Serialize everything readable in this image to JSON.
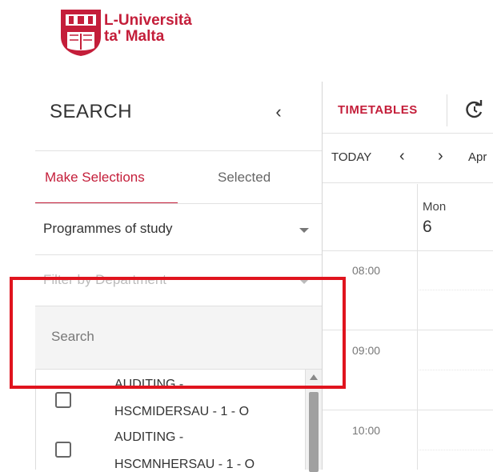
{
  "brand": {
    "name_line1": "L-Università",
    "name_line2": "ta' Malta",
    "color": "#c41e3a"
  },
  "left_panel": {
    "title": "SEARCH",
    "collapse_glyph": "‹",
    "tabs": [
      {
        "label": "Make Selections",
        "active": true
      },
      {
        "label": "Selected",
        "active": false
      }
    ],
    "type_dropdown": {
      "selected": "Programmes of study"
    },
    "department_dropdown": {
      "selected": "Filter by Department"
    },
    "search": {
      "placeholder": "Search"
    },
    "list_items": [
      {
        "line1": "AUDITING -",
        "line2": "HSCMIDERSAU - 1 - O",
        "checked": false
      },
      {
        "line1": "AUDITING -",
        "line2": "HSCMNHERSAU - 1 - O",
        "checked": false
      }
    ]
  },
  "toolbar": {
    "title": "TIMETABLES",
    "refresh_icon": "refresh-icon"
  },
  "calendar_nav": {
    "today_label": "TODAY",
    "prev_glyph": "‹",
    "next_glyph": "›",
    "month_label": "Apr"
  },
  "day_header": {
    "day_name": "Mon",
    "day_number": "6"
  },
  "times": [
    "08:00",
    "09:00",
    "10:00"
  ],
  "highlight_color": "#e0141e"
}
